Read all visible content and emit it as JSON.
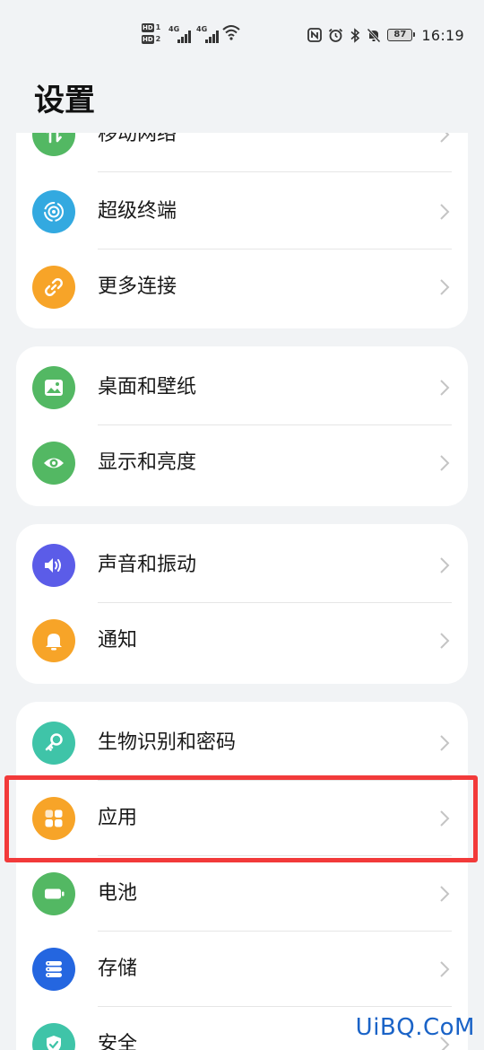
{
  "status_bar": {
    "sim1": {
      "badge": "HD",
      "num": "1",
      "net": "4G"
    },
    "sim2": {
      "badge": "HD",
      "num": "2",
      "net": "4G"
    },
    "battery": "87",
    "time": "16:19",
    "icons": [
      "nfc-icon",
      "alarm-icon",
      "bluetooth-icon",
      "mute-icon"
    ]
  },
  "page": {
    "title": "设置"
  },
  "sections": [
    {
      "items": [
        {
          "label": "移动网络",
          "icon": "mobile-network-icon",
          "color": "#53b863"
        },
        {
          "label": "超级终端",
          "icon": "super-device-icon",
          "color": "#33a9e0"
        },
        {
          "label": "更多连接",
          "icon": "link-icon",
          "color": "#f7a428"
        }
      ]
    },
    {
      "items": [
        {
          "label": "桌面和壁纸",
          "icon": "wallpaper-icon",
          "color": "#53b863"
        },
        {
          "label": "显示和亮度",
          "icon": "eye-icon",
          "color": "#53b863"
        }
      ]
    },
    {
      "items": [
        {
          "label": "声音和振动",
          "icon": "speaker-icon",
          "color": "#5b5ce8"
        },
        {
          "label": "通知",
          "icon": "bell-icon",
          "color": "#f7a428"
        }
      ]
    },
    {
      "items": [
        {
          "label": "生物识别和密码",
          "icon": "key-icon",
          "color": "#3fc4a8"
        },
        {
          "label": "应用",
          "icon": "apps-icon",
          "color": "#f7a428"
        },
        {
          "label": "电池",
          "icon": "battery-icon",
          "color": "#53b863"
        },
        {
          "label": "存储",
          "icon": "storage-icon",
          "color": "#2466e0"
        },
        {
          "label": "安全",
          "icon": "shield-icon",
          "color": "#3fc4a8"
        }
      ]
    }
  ],
  "highlight_color": "#f23a3a",
  "watermark": "UiBQ.CoM"
}
